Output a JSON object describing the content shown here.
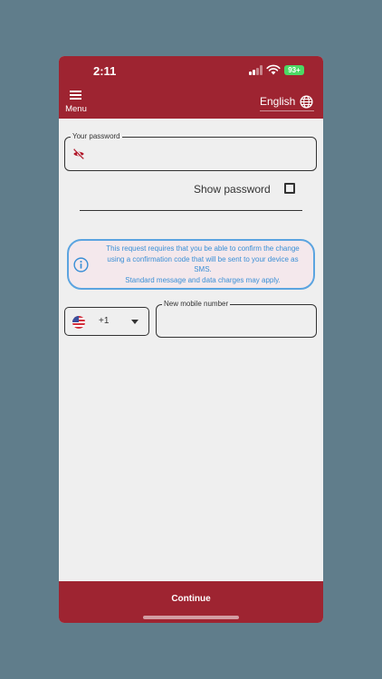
{
  "status_bar": {
    "time": "2:11",
    "battery": "93+",
    "icons": [
      "cellular-signal-icon",
      "wifi-icon",
      "battery-icon"
    ]
  },
  "app_bar": {
    "menu_label": "Menu",
    "language": "English",
    "icons": [
      "hamburger-menu-icon",
      "globe-icon"
    ]
  },
  "form": {
    "password_label": "Your password",
    "password_value": "",
    "show_password_label": "Show password",
    "show_password_checked": false,
    "info_lines": [
      "This request requires that you be able to confirm the change",
      "using a confirmation code that will be sent to your device as",
      "SMS.",
      "Standard message and data charges may apply."
    ],
    "country_code": "+1",
    "mobile_label": "New mobile number",
    "mobile_value": ""
  },
  "footer": {
    "continue_label": "Continue"
  },
  "colors": {
    "brand": "#9e2431",
    "background": "#607d8b",
    "surface": "#efefef",
    "info_accent": "#3a8fd6",
    "battery": "#4cd964"
  }
}
